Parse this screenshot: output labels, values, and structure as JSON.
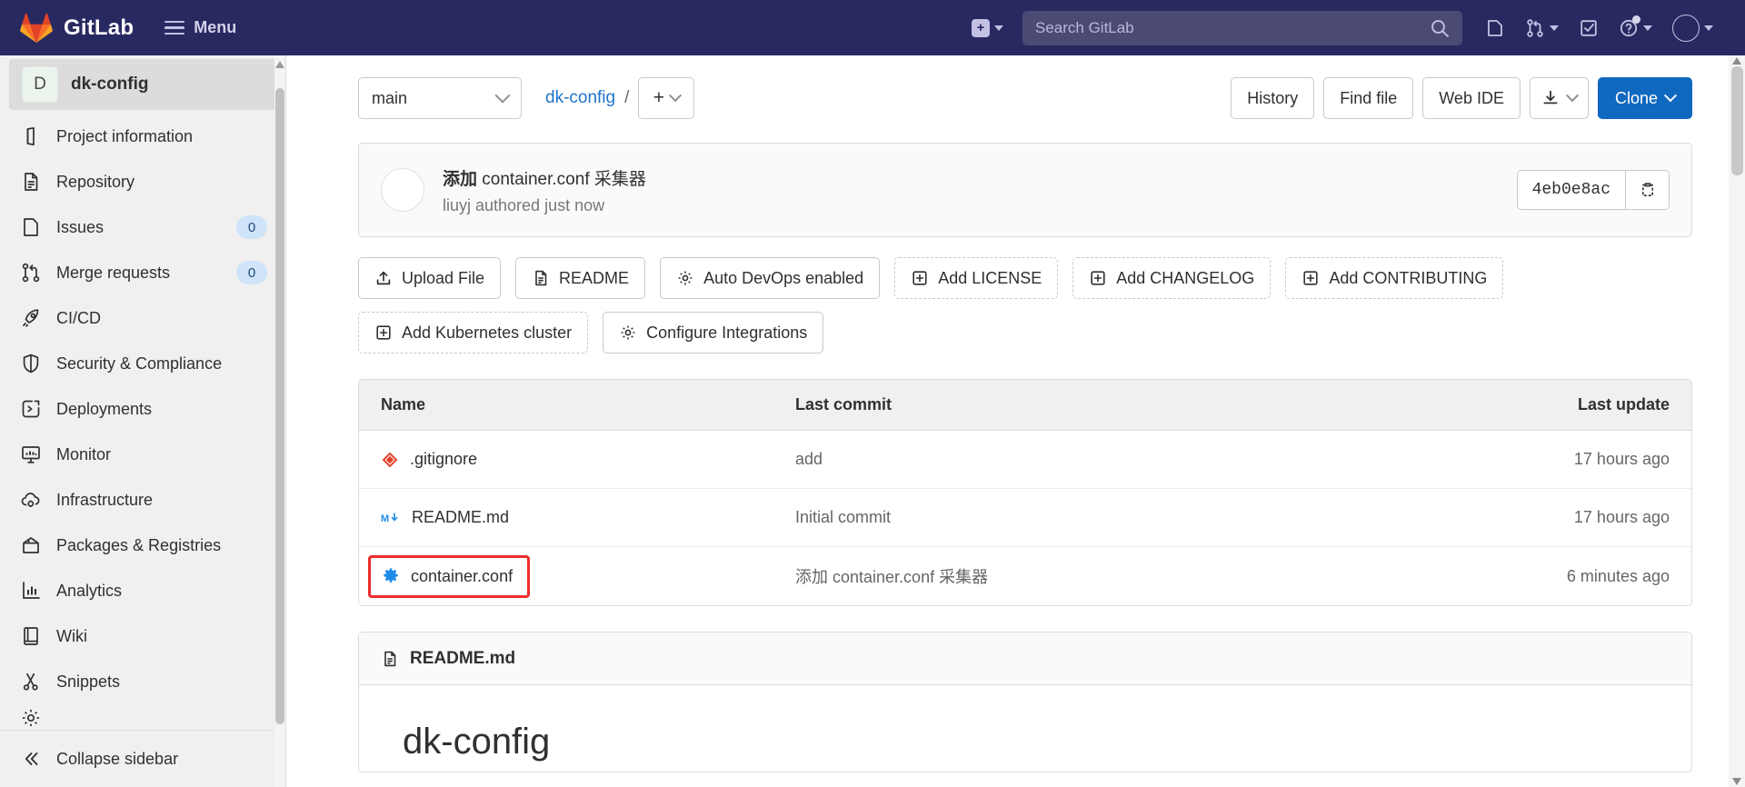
{
  "navbar": {
    "brand": "GitLab",
    "menu_label": "Menu",
    "search_placeholder": "Search GitLab",
    "icons": {
      "new": "plus-square-icon",
      "new_caret": "chevron-down-icon",
      "search": "search-icon",
      "issues": "issues-icon",
      "merge_requests": "merge-request-icon",
      "todos": "todo-checkbox-icon",
      "help": "help-question-icon",
      "avatar": "user-avatar-icon"
    },
    "bg_color": "#292961"
  },
  "sidebar": {
    "project": {
      "initial": "D",
      "name": "dk-config"
    },
    "items": [
      {
        "label": "Project information",
        "icon": "project-info-icon",
        "badge": null
      },
      {
        "label": "Repository",
        "icon": "document-icon",
        "badge": null
      },
      {
        "label": "Issues",
        "icon": "issues-icon",
        "badge": "0"
      },
      {
        "label": "Merge requests",
        "icon": "merge-request-icon",
        "badge": "0"
      },
      {
        "label": "CI/CD",
        "icon": "rocket-icon",
        "badge": null
      },
      {
        "label": "Security & Compliance",
        "icon": "shield-icon",
        "badge": null
      },
      {
        "label": "Deployments",
        "icon": "deployments-icon",
        "badge": null
      },
      {
        "label": "Monitor",
        "icon": "monitor-icon",
        "badge": null
      },
      {
        "label": "Infrastructure",
        "icon": "cloud-gear-icon",
        "badge": null
      },
      {
        "label": "Packages & Registries",
        "icon": "package-icon",
        "badge": null
      },
      {
        "label": "Analytics",
        "icon": "chart-icon",
        "badge": null
      },
      {
        "label": "Wiki",
        "icon": "book-icon",
        "badge": null
      },
      {
        "label": "Snippets",
        "icon": "scissors-icon",
        "badge": null
      }
    ],
    "collapse_label": "Collapse sidebar",
    "collapse_icon": "chevron-double-left-icon"
  },
  "toolbar": {
    "branch": "main",
    "breadcrumb_repo": "dk-config",
    "breadcrumb_sep": "/",
    "add_label": "+",
    "history_label": "History",
    "find_file_label": "Find file",
    "web_ide_label": "Web IDE",
    "download_icon": "download-icon",
    "clone_label": "Clone"
  },
  "commit": {
    "title_bold": "添加",
    "title_rest": " container.conf 采集器",
    "author_line": "liuyj authored just now",
    "sha": "4eb0e8ac",
    "copy_icon": "clipboard-icon"
  },
  "actions": [
    {
      "label": "Upload File",
      "icon": "upload-icon",
      "dashed": false
    },
    {
      "label": "README",
      "icon": "document-icon",
      "dashed": false
    },
    {
      "label": "Auto DevOps enabled",
      "icon": "gear-icon",
      "dashed": false
    },
    {
      "label": "Add LICENSE",
      "icon": "plus-box-icon",
      "dashed": true
    },
    {
      "label": "Add CHANGELOG",
      "icon": "plus-box-icon",
      "dashed": true
    },
    {
      "label": "Add CONTRIBUTING",
      "icon": "plus-box-icon",
      "dashed": true
    },
    {
      "label": "Add Kubernetes cluster",
      "icon": "plus-box-icon",
      "dashed": true
    },
    {
      "label": "Configure Integrations",
      "icon": "gear-icon",
      "dashed": false
    }
  ],
  "filetable": {
    "columns": {
      "name": "Name",
      "last_commit": "Last commit",
      "last_update": "Last update"
    },
    "rows": [
      {
        "name": ".gitignore",
        "icon": "git-file-icon",
        "last_commit": "add",
        "last_update": "17 hours ago",
        "highlighted": false
      },
      {
        "name": "README.md",
        "icon": "markdown-icon",
        "last_commit": "Initial commit",
        "last_update": "17 hours ago",
        "highlighted": false
      },
      {
        "name": "container.conf",
        "icon": "gear-file-icon",
        "last_commit": "添加 container.conf 采集器",
        "last_update": "6 minutes ago",
        "highlighted": true
      }
    ]
  },
  "readme": {
    "filename": "README.md",
    "file_icon": "document-icon",
    "heading": "dk-config"
  },
  "colors": {
    "navy": "#292961",
    "link_blue": "#1f75cb",
    "button_blue": "#1068bf",
    "highlight_red": "#ef2b2b",
    "gear_blue": "#1f8ceb",
    "git_orange": "#e24329"
  }
}
